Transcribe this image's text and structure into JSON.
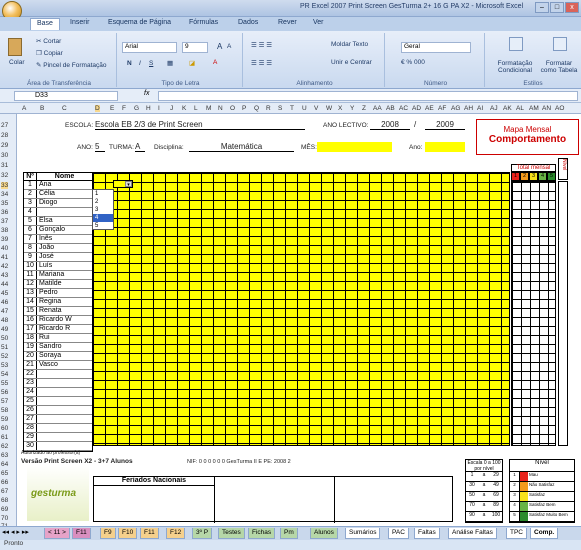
{
  "window": {
    "title": "PR Excel 2007 Print Screen GesTurma 2+ 16 G PA X2 - Microsoft Excel",
    "buttons": [
      "–",
      "□",
      "x"
    ]
  },
  "ribbon_tabs": [
    "Base",
    "Inserir",
    "Esquema de Página",
    "Fórmulas",
    "Dados",
    "Rever",
    "Ver"
  ],
  "ribbon": {
    "clipboard": {
      "paste": "Colar",
      "cut": "Cortar",
      "copy": "Copiar",
      "format_painter": "Pincel de Formatação",
      "label": "Área de Transferência"
    },
    "font": {
      "name": "Arial",
      "size": "9",
      "label": "Tipo de Letra",
      "bold": "N",
      "italic": "I",
      "underline": "S"
    },
    "alignment": {
      "wrap": "Moldar Texto",
      "merge": "Unir e Centrar",
      "label": "Alinhamento"
    },
    "number": {
      "format": "Geral",
      "label": "Número"
    },
    "styles": {
      "conditional": "Formatação Condicional",
      "table": "Formatar como Tabela",
      "label": "Estilos"
    }
  },
  "namebox": "D33",
  "fx": "fx",
  "columns": [
    "A",
    "B",
    "C",
    "D",
    "E",
    "F",
    "G",
    "H",
    "I",
    "J",
    "K",
    "L",
    "M",
    "N",
    "O",
    "P",
    "Q",
    "R",
    "S",
    "T",
    "U",
    "V",
    "W",
    "X",
    "Y",
    "Z",
    "AA",
    "AB",
    "AC",
    "AD",
    "AE",
    "AF",
    "AG",
    "AH",
    "AI",
    "AJ",
    "AK",
    "AL",
    "AM",
    "AN",
    "AO"
  ],
  "rows": [
    "27",
    "28",
    "29",
    "30",
    "31",
    "32",
    "33",
    "34",
    "35",
    "36",
    "37",
    "38",
    "39",
    "40",
    "41",
    "42",
    "43",
    "44",
    "45",
    "46",
    "47",
    "48",
    "49",
    "50",
    "51",
    "52",
    "53",
    "54",
    "55",
    "56",
    "57",
    "58",
    "59",
    "60",
    "61",
    "62",
    "63",
    "64",
    "65",
    "66",
    "67",
    "68",
    "69",
    "70",
    "71",
    "72",
    "73"
  ],
  "header": {
    "escola_label": "ESCOLA:",
    "escola": "Escola EB 2/3 de Print Screen",
    "ano_lectivo_label": "ANO LECTIVO:",
    "ano1": "2008",
    "slash": "/",
    "ano2": "2009",
    "ano_label": "ANO:",
    "ano": "5",
    "turma_label": "TURMA:",
    "turma": "A",
    "disciplina_label": "Disciplina:",
    "disciplina": "Matemática",
    "mes_label": "MÊS:",
    "ano_label2": "Ano:"
  },
  "mapa": {
    "line1": "Mapa Mensal",
    "line2": "Comportamento"
  },
  "table_headers": {
    "n": "Nº",
    "nome": "Nome",
    "total": "Total mensal",
    "nivel": "Nível"
  },
  "total_cols": [
    "1",
    "2",
    "3",
    "4",
    "5"
  ],
  "students": [
    {
      "n": "1",
      "nome": "Ana"
    },
    {
      "n": "2",
      "nome": "Célia"
    },
    {
      "n": "3",
      "nome": "Diogo"
    },
    {
      "n": "4",
      "nome": ""
    },
    {
      "n": "5",
      "nome": "Elsa"
    },
    {
      "n": "6",
      "nome": "Gonçalo"
    },
    {
      "n": "7",
      "nome": "Inês"
    },
    {
      "n": "8",
      "nome": "João"
    },
    {
      "n": "9",
      "nome": "José"
    },
    {
      "n": "10",
      "nome": "Luís"
    },
    {
      "n": "11",
      "nome": "Mariana"
    },
    {
      "n": "12",
      "nome": "Matilde"
    },
    {
      "n": "13",
      "nome": "Pedro"
    },
    {
      "n": "14",
      "nome": "Regina"
    },
    {
      "n": "15",
      "nome": "Renata"
    },
    {
      "n": "16",
      "nome": "Ricardo W"
    },
    {
      "n": "17",
      "nome": "Ricardo R"
    },
    {
      "n": "18",
      "nome": "Rui"
    },
    {
      "n": "19",
      "nome": "Sandro"
    },
    {
      "n": "20",
      "nome": "Soraya"
    },
    {
      "n": "21",
      "nome": "Vasco"
    },
    {
      "n": "22",
      "nome": ""
    },
    {
      "n": "23",
      "nome": ""
    },
    {
      "n": "24",
      "nome": ""
    },
    {
      "n": "25",
      "nome": ""
    },
    {
      "n": "26",
      "nome": ""
    },
    {
      "n": "27",
      "nome": ""
    },
    {
      "n": "28",
      "nome": ""
    },
    {
      "n": "29",
      "nome": ""
    },
    {
      "n": "30",
      "nome": ""
    }
  ],
  "dropdown_options": [
    "1",
    "2",
    "3",
    "4",
    "5"
  ],
  "footer": {
    "autor": "Autorizado ao professor(a)",
    "version": "Versão Print Screen X2 - 3+7 Alunos",
    "nif": "NIF: 0 0 0 0 0 0   GesTurma II E PE:  2008   2",
    "feriados": "Feriados Nacionais",
    "logo": "gesturma",
    "escala_title": "Escala 0 a 100 por nível",
    "escala": [
      [
        "1",
        "a",
        "29"
      ],
      [
        "30",
        "a",
        "49"
      ],
      [
        "50",
        "a",
        "69"
      ],
      [
        "70",
        "a",
        "89"
      ],
      [
        "90",
        "a",
        "100"
      ]
    ],
    "nivel_title": "Nível",
    "niveis": [
      {
        "n": "1",
        "label": "Mau",
        "color": "#e8231c"
      },
      {
        "n": "2",
        "label": "Não Satisfaz",
        "color": "#f39a1c"
      },
      {
        "n": "3",
        "label": "Satisfaz",
        "color": "#f7e21a"
      },
      {
        "n": "4",
        "label": "Satisfaz Bem",
        "color": "#68b445"
      },
      {
        "n": "5",
        "label": "Satisfaz Muito Bem",
        "color": "#2c8b2c"
      }
    ]
  },
  "sheet_tabs": [
    "< 11 >",
    "F11",
    "F9",
    "F10",
    "F11",
    "F12",
    "3º P",
    "Testes",
    "Fichas",
    "Pm",
    "Alunos",
    "Sumários",
    "PAC",
    "Faltas",
    "Análise Faltas",
    "TPC",
    "Comp."
  ],
  "status": "Pronto"
}
